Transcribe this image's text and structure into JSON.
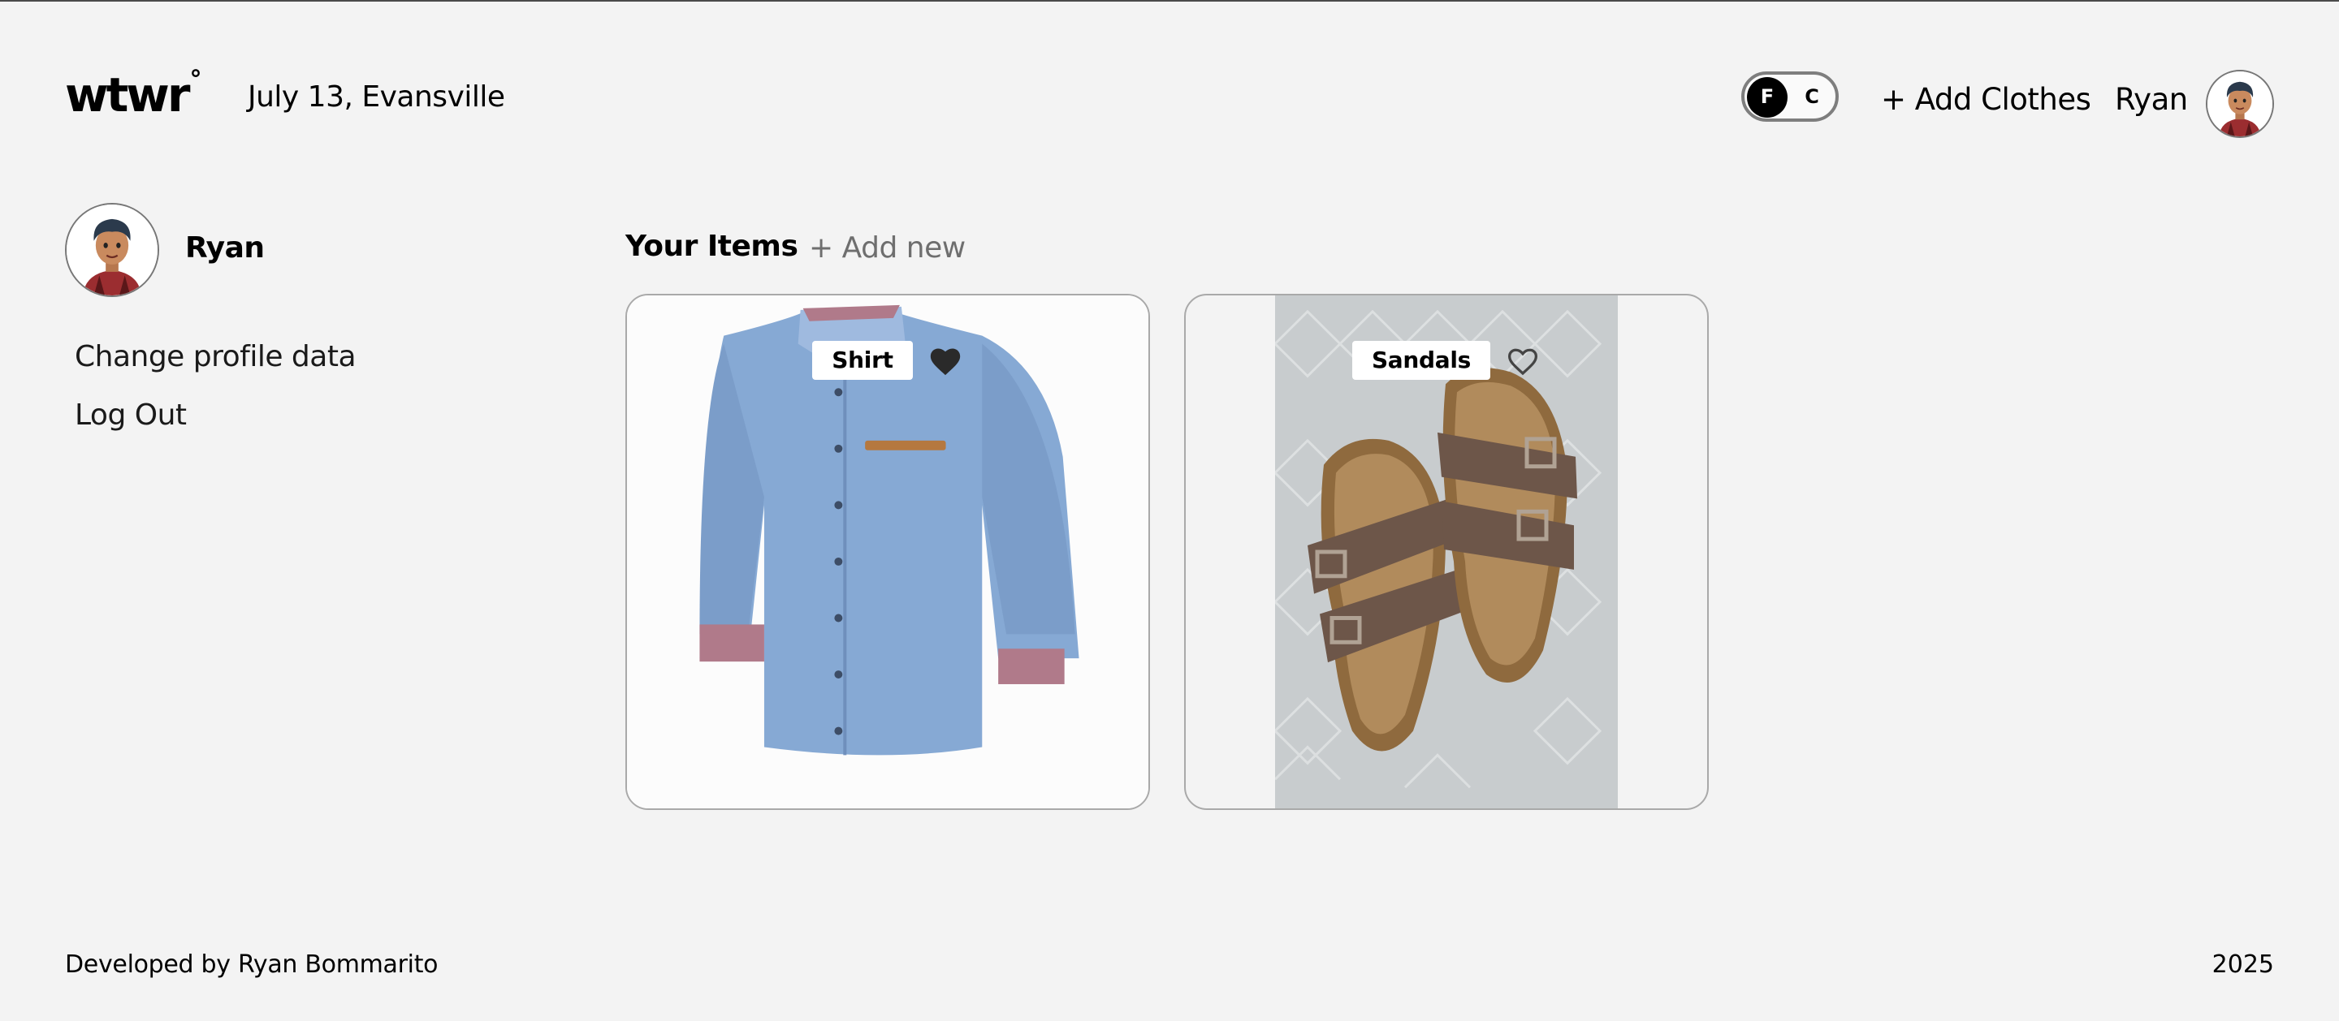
{
  "header": {
    "logo": "wtwr",
    "logo_mark": "°",
    "date_location": "July 13, Evansville",
    "unit_toggle": {
      "options": [
        "F",
        "C"
      ],
      "selected": "F"
    },
    "add_clothes_label": "+ Add Clothes",
    "user_name": "Ryan",
    "avatar_icon": "user-avatar-icon"
  },
  "sidebar": {
    "user_name": "Ryan",
    "avatar_icon": "user-avatar-icon",
    "links": [
      "Change profile data",
      "Log Out"
    ]
  },
  "main": {
    "section_title": "Your Items",
    "add_new_label": "+ Add new",
    "items": [
      {
        "name": "Shirt",
        "image": "blue-denim-shirt",
        "liked": true
      },
      {
        "name": "Sandals",
        "image": "brown-sandals",
        "liked": false
      }
    ]
  },
  "footer": {
    "credit": "Developed by Ryan Bommarito",
    "year": "2025"
  },
  "colors": {
    "background": "#f3f3f3",
    "text": "#000000",
    "muted": "#6e6e6e",
    "card_border": "#a9a9a9",
    "toggle_knob": "#000000"
  }
}
